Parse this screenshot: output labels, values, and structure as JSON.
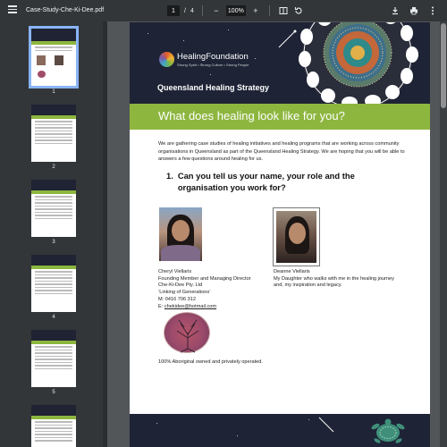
{
  "toolbar": {
    "title": "Case-Study-Che-Ki-Dee.pdf",
    "page_current": "1",
    "page_separator": "/",
    "page_total": "4",
    "zoom": "100%",
    "zoom_out": "−",
    "zoom_in": "+"
  },
  "sidebar": {
    "pages": [
      "1",
      "2",
      "3",
      "4",
      "5"
    ]
  },
  "doc": {
    "brand": "HealingFoundation",
    "tagline": "Strong Spirit • Strong Culture • Strong People",
    "strategy": "Queensland Healing Strategy",
    "heading": "What does healing look like for you?",
    "intro": "We are gathering case studies of healing initiatives and healing programs that are working across community organisations in Queensland as part of the Queensland Healing Strategy. We are hoping that you will be able to answers a few questions around healing for us.",
    "question_num": "1.",
    "question": "Can you tell us your name, your role and the organisation you work for?",
    "person1": {
      "name": "Cheryl Viellaris",
      "role": "Founding Member and Managing Director",
      "org": "Che-Ki-Dee Pty. Ltd",
      "tag": "‘Linking of Generations’",
      "mobile": "M: 0416 706 312",
      "email_prefix": "E: ",
      "email": "chekidee@hotmail.com"
    },
    "person2": {
      "name": "Deanne Viellaris",
      "desc": "My Daughter who walks with me in the healing journey and, my inspiration and legacy."
    },
    "owned": "100% Aboriginal owned and privately operated."
  },
  "colors": {
    "accent_green": "#8db63f",
    "header_navy": "#1e2336",
    "toolbar": "#323639"
  }
}
